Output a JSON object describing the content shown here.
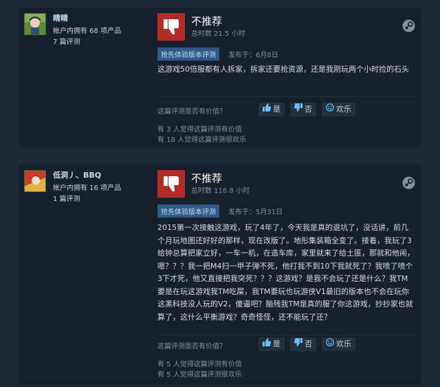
{
  "reviews": [
    {
      "reviewer": {
        "name": "睛睛",
        "products": "帐户内拥有 68 项产品",
        "reviews": "7 篇评测"
      },
      "verdict": "不推荐",
      "hours": "总时数 21.5 小时",
      "badge": "抢先体验版本评测",
      "posted": "发布于：6月8日",
      "text": "这游戏50倍服都有人拆家，拆家还要抢资源，还是我刚玩两个小时捡的石头",
      "vote_question": "这篇评测是否有价值？",
      "buttons": {
        "yes": "是",
        "no": "否",
        "funny": "欢乐"
      },
      "helpful": "有 3 人觉得这篇评测有价值",
      "funny_count": "有 18 人觉得这篇评测很欢乐"
    },
    {
      "reviewer": {
        "name": "低洞丿、BBQ",
        "products": "帐户内拥有 16 项产品",
        "reviews": "1 篇评测"
      },
      "verdict": "不推荐",
      "hours": "总时数 116.8 小时",
      "badge": "抢先体验版本评测",
      "posted": "发布于：5月31日",
      "text": "2015第一次接触这游戏，玩了4年了，今天我是真的退坑了，没话讲，前几个月玩地图还好好的那样，现在改版了。地形集装箱全变了。接着，我玩了3给钟总算把家立好，一车一机，在造车库，家里就来了给土匪，那就和他闹，嗯？？？我一把M4扫一甲子弹不死，他打我不到10下我就死了？我喷了喷个3下才死，他又直接把我突死？？？这游戏？是我不会玩了还是什么？我TM要是在玩这游戏我TM吃屎，我TM要玩也玩游侠V1最旧的版本也不会在玩你这黑科技没人玩的V2，傻逼吧？脑残我TM是真的服了你这游戏，抄抄家也就算了，这什么平衡游戏？奇奇怪怪，还不能玩了还？",
      "vote_question": "这篇评测是否有价值？",
      "buttons": {
        "yes": "是",
        "no": "否",
        "funny": "欢乐"
      },
      "helpful": "有 5 人觉得这篇评测有价值",
      "funny_count": "有 5 人觉得这篇评测很欢乐"
    }
  ],
  "colors": {
    "page_bg": "#1b2838",
    "card_bg": "#16202d",
    "not_recommended": "#b12c25",
    "badge_bg": "#2f5a88",
    "link_blue": "#66c0f4"
  },
  "icons": {
    "thumb": "thumbs-down-icon",
    "platform": "steam-icon",
    "vote_yes": "thumbs-up-icon",
    "vote_no": "thumbs-down-small-icon",
    "vote_funny": "smiley-icon"
  }
}
